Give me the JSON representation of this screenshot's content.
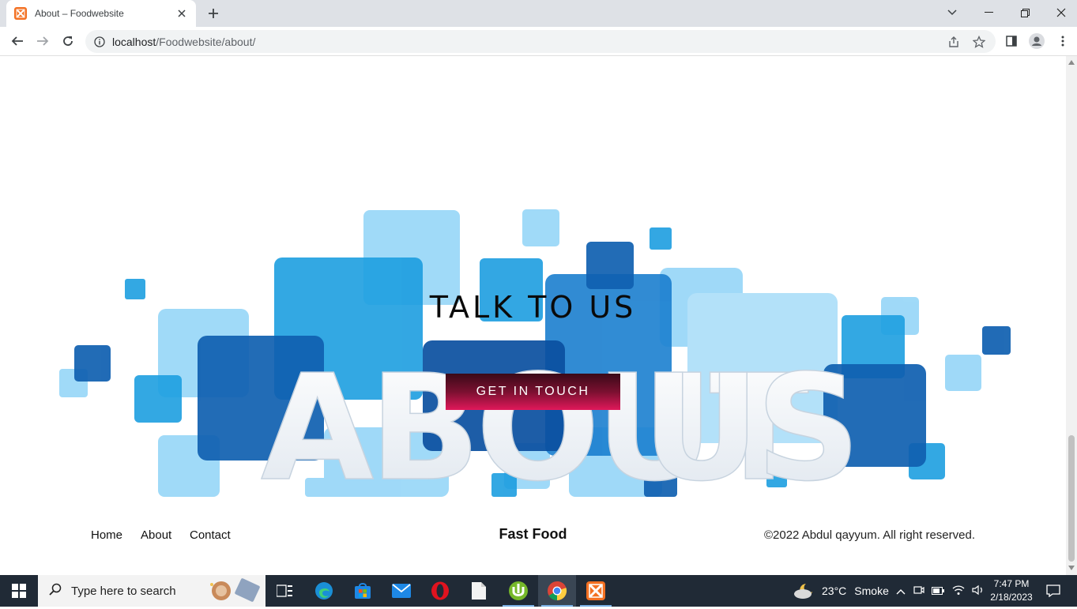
{
  "browser": {
    "tab_title": "About – Foodwebsite",
    "url_host": "localhost",
    "url_path": "/Foodwebsite/about/"
  },
  "page": {
    "hero_image_alt_text": "ABOUT US",
    "heading": "TALK TO US",
    "cta_label": "GET IN TOUCH",
    "footer": {
      "links": [
        "Home",
        "About",
        "Contact"
      ],
      "brand": "Fast Food",
      "copyright": "©2022 Abdul qayyum. All right reserved."
    }
  },
  "taskbar": {
    "search_placeholder": "Type here to search",
    "weather_temp": "23°C",
    "weather_desc": "Smoke",
    "time": "7:47 PM",
    "date": "2/18/2023"
  },
  "colors": {
    "cta_gradient_top": "#3a0a18",
    "cta_gradient_bottom": "#e0185a",
    "taskbar_bg": "#202a36"
  }
}
